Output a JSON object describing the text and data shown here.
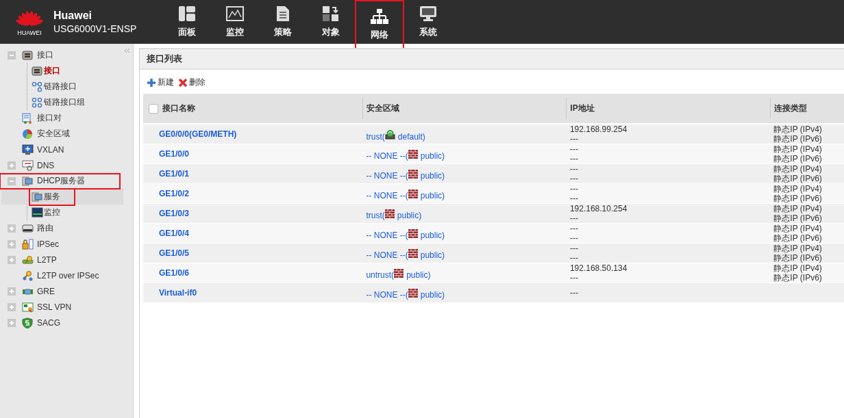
{
  "header": {
    "logo_text": "HUAWEI",
    "brand": "Huawei",
    "model": "USG6000V1-ENSP",
    "nav": [
      {
        "label": "面板",
        "highlighted": false
      },
      {
        "label": "监控",
        "highlighted": false
      },
      {
        "label": "策略",
        "highlighted": false
      },
      {
        "label": "对象",
        "highlighted": false
      },
      {
        "label": "网络",
        "highlighted": true
      },
      {
        "label": "系统",
        "highlighted": false
      }
    ]
  },
  "sidebar": {
    "items": [
      {
        "label": "接口",
        "expanded": true,
        "highlighted": false,
        "children": [
          {
            "label": "接口",
            "selected": true,
            "hovered": false,
            "highlighted": false
          },
          {
            "label": "链路接口",
            "selected": false,
            "hovered": false,
            "highlighted": false
          },
          {
            "label": "链路接口组",
            "selected": false,
            "hovered": false,
            "highlighted": false
          }
        ]
      },
      {
        "label": "接口对",
        "highlighted": false
      },
      {
        "label": "安全区域",
        "highlighted": false
      },
      {
        "label": "VXLAN",
        "highlighted": false
      },
      {
        "label": "DNS",
        "expanded": false,
        "highlighted": false
      },
      {
        "label": "DHCP服务器",
        "expanded": true,
        "highlighted": true,
        "children": [
          {
            "label": "服务",
            "selected": false,
            "hovered": true,
            "highlighted": true
          },
          {
            "label": "监控",
            "selected": false,
            "hovered": false,
            "highlighted": false
          }
        ]
      },
      {
        "label": "路由",
        "expanded": false,
        "highlighted": false
      },
      {
        "label": "IPSec",
        "expanded": false,
        "highlighted": false
      },
      {
        "label": "L2TP",
        "expanded": false,
        "highlighted": false
      },
      {
        "label": "L2TP over IPSec",
        "highlighted": false
      },
      {
        "label": "GRE",
        "expanded": false,
        "highlighted": false
      },
      {
        "label": "SSL VPN",
        "expanded": false,
        "highlighted": false
      },
      {
        "label": "SACG",
        "expanded": false,
        "highlighted": false
      }
    ]
  },
  "panel": {
    "title": "接口列表",
    "toolbar": [
      {
        "label": "新建",
        "kind": "add"
      },
      {
        "label": "删除",
        "kind": "delete"
      }
    ],
    "table": {
      "select_all": {
        "checked": false
      },
      "columns": [
        "接口名称",
        "安全区域",
        "IP地址",
        "连接类型"
      ],
      "rows": [
        {
          "kind": "device",
          "name": "GE0/0/0(GE0/METH)",
          "zone": "trust(",
          "vsys": "default)",
          "ip": [
            "192.168.99.254",
            "---"
          ],
          "type": [
            "静态IP (IPv4)",
            "静态IP (IPv6)"
          ]
        },
        {
          "kind": "firewall",
          "name": "GE1/0/0",
          "zone": "-- NONE --(",
          "vsys": "public)",
          "ip": [
            "---",
            "---"
          ],
          "type": [
            "静态IP (IPv4)",
            "静态IP (IPv6)"
          ]
        },
        {
          "kind": "firewall",
          "name": "GE1/0/1",
          "zone": "-- NONE --(",
          "vsys": "public)",
          "ip": [
            "---",
            "---"
          ],
          "type": [
            "静态IP (IPv4)",
            "静态IP (IPv6)"
          ]
        },
        {
          "kind": "firewall",
          "name": "GE1/0/2",
          "zone": "-- NONE --(",
          "vsys": "public)",
          "ip": [
            "---",
            "---"
          ],
          "type": [
            "静态IP (IPv4)",
            "静态IP (IPv6)"
          ]
        },
        {
          "kind": "firewall",
          "name": "GE1/0/3",
          "zone": "trust(",
          "vsys": "public)",
          "ip": [
            "192.168.10.254",
            "---"
          ],
          "type": [
            "静态IP (IPv4)",
            "静态IP (IPv6)"
          ]
        },
        {
          "kind": "firewall",
          "name": "GE1/0/4",
          "zone": "-- NONE --(",
          "vsys": "public)",
          "ip": [
            "---",
            "---"
          ],
          "type": [
            "静态IP (IPv4)",
            "静态IP (IPv6)"
          ]
        },
        {
          "kind": "firewall",
          "name": "GE1/0/5",
          "zone": "-- NONE --(",
          "vsys": "public)",
          "ip": [
            "---",
            "---"
          ],
          "type": [
            "静态IP (IPv4)",
            "静态IP (IPv6)"
          ]
        },
        {
          "kind": "firewall",
          "name": "GE1/0/6",
          "zone": "untrust(",
          "vsys": "public)",
          "ip": [
            "192.168.50.134",
            "---"
          ],
          "type": [
            "静态IP (IPv4)",
            "静态IP (IPv6)"
          ]
        },
        {
          "kind": "firewall",
          "name": "Virtual-if0",
          "zone": "-- NONE --(",
          "vsys": "public)",
          "ip": [
            "---"
          ],
          "type": []
        }
      ]
    }
  }
}
